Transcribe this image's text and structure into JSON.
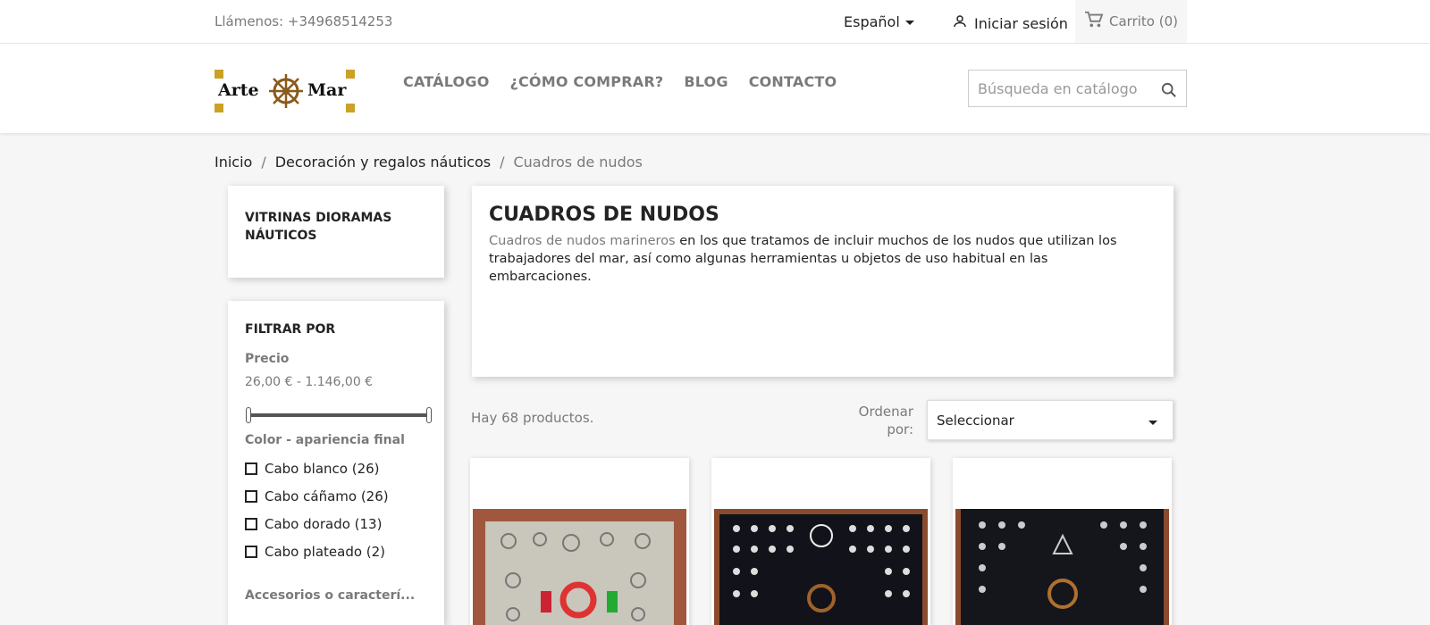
{
  "topbar": {
    "phone": "Llámenos: +34968514253",
    "language": "Español",
    "login": "Iniciar sesión",
    "cart": "Carrito (0)"
  },
  "header": {
    "logo_left": "Arte",
    "logo_right": "Mar",
    "nav": [
      "CATÁLOGO",
      "¿CÓMO COMPRAR?",
      "BLOG",
      "CONTACTO"
    ],
    "search_placeholder": "Búsqueda en catálogo"
  },
  "breadcrumb": [
    "Inicio",
    "Decoración y regalos náuticos",
    "Cuadros de nudos"
  ],
  "sidebar": {
    "category": "VITRINAS DIORAMAS NÁUTICOS",
    "filter_title": "FILTRAR POR",
    "price_label": "Precio",
    "price_range": "26,00 € - 1.146,00 €",
    "color_label": "Color - apariencia final",
    "colors": [
      "Cabo blanco (26)",
      "Cabo cáñamo (26)",
      "Cabo dorado (13)",
      "Cabo plateado (2)"
    ],
    "accessories_label": "Accesorios o caracterí..."
  },
  "category": {
    "title": "CUADROS DE NUDOS",
    "desc_link": "Cuadros de nudos marineros",
    "desc_rest": " en los que tratamos de incluir muchos de los nudos que utilizan los trabajadores del mar, así como algunas herramientas u objetos de uso habitual en las embarcaciones."
  },
  "listing": {
    "count": "Hay 68 productos.",
    "sort_label": "Ordenar por:",
    "sort_value": "Seleccionar"
  },
  "colors": {
    "accent": "#c9a227",
    "text": "#232323",
    "muted": "#7a7a7a",
    "page_bg": "#f6f6f6"
  },
  "icons": [
    "chevron-down-icon",
    "user-icon",
    "cart-icon",
    "search-icon",
    "ship-wheel-icon"
  ]
}
